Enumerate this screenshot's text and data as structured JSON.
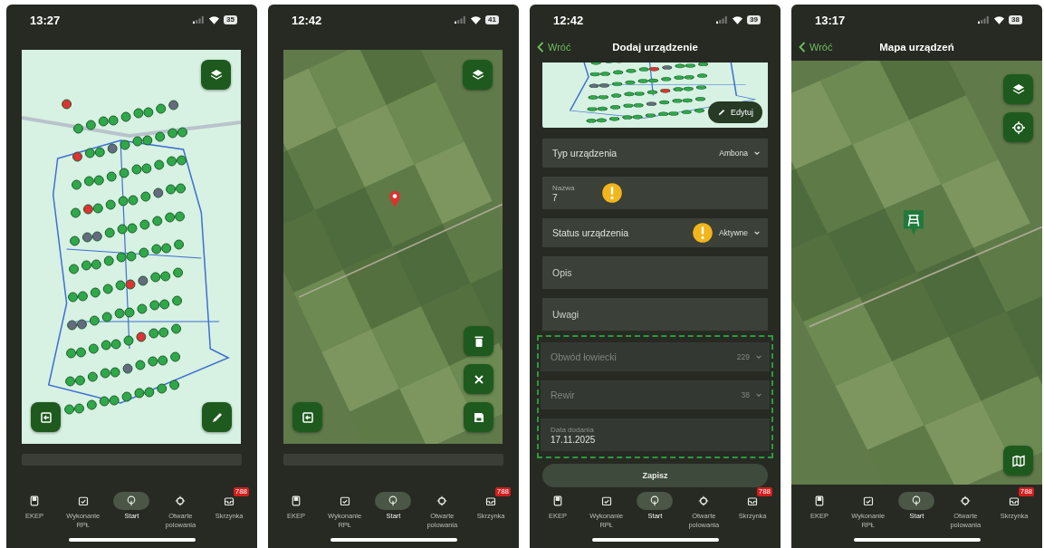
{
  "screens": [
    {
      "kind": "device_map",
      "status": {
        "time": "13:27",
        "battery": "35"
      },
      "nav": [
        {
          "label": "EKEP",
          "selected": false
        },
        {
          "label": "Wykonanie RPŁ",
          "selected": false
        },
        {
          "label": "Start",
          "selected": true
        },
        {
          "label": "Otwarte polowania",
          "selected": false
        },
        {
          "label": "Skrzynka",
          "selected": false,
          "badge": "788"
        }
      ]
    },
    {
      "kind": "device_edit_map",
      "status": {
        "time": "12:42",
        "battery": "41"
      },
      "nav": [
        {
          "label": "EKEP",
          "selected": false
        },
        {
          "label": "Wykonanie RPŁ",
          "selected": false
        },
        {
          "label": "Start",
          "selected": true
        },
        {
          "label": "Otwarte polowania",
          "selected": false
        },
        {
          "label": "Skrzynka",
          "selected": false,
          "badge": "788"
        }
      ]
    },
    {
      "kind": "device_form",
      "status": {
        "time": "12:42",
        "battery": "39"
      },
      "header": {
        "back": "Wróć",
        "title": "Dodaj urządzenie"
      },
      "map_button": "Edytuj",
      "fields": [
        {
          "kind": "select",
          "label": "Typ urządzenia",
          "value": "Ambona",
          "warning": false,
          "disabled": false
        },
        {
          "kind": "text",
          "label": "Nazwa",
          "value": "7",
          "warning": true,
          "disabled": false
        },
        {
          "kind": "select",
          "label": "Status urządzenia",
          "value": "Aktywne",
          "warning": true,
          "disabled": false
        },
        {
          "kind": "empty",
          "placeholder": "Opis",
          "warning": false,
          "disabled": false
        },
        {
          "kind": "empty",
          "placeholder": "Uwagi",
          "warning": false,
          "disabled": false
        }
      ],
      "locked_fields": [
        {
          "kind": "select",
          "label": "Obwód łowiecki",
          "value": "229",
          "warning": false,
          "disabled": true
        },
        {
          "kind": "select",
          "label": "Rewir",
          "value": "38",
          "warning": false,
          "disabled": true
        },
        {
          "kind": "text",
          "label": "Data dodania",
          "value": "17.11.2025",
          "warning": false,
          "disabled": true
        }
      ],
      "submit": "Zapisz",
      "nav": [
        {
          "label": "EKEP",
          "selected": false
        },
        {
          "label": "Wykonanie RPŁ",
          "selected": false
        },
        {
          "label": "Start",
          "selected": true
        },
        {
          "label": "Otwarte polowania",
          "selected": false
        },
        {
          "label": "Skrzynka",
          "selected": false,
          "badge": "788"
        }
      ]
    },
    {
      "kind": "device_map_view",
      "status": {
        "time": "13:17",
        "battery": "38"
      },
      "header": {
        "back": "Wróć",
        "title": "Mapa urządzeń"
      },
      "nav": [
        {
          "label": "EKEP",
          "selected": false
        },
        {
          "label": "Wykonanie RPŁ",
          "selected": false
        },
        {
          "label": "Start",
          "selected": true
        },
        {
          "label": "Otwarte polowania",
          "selected": false
        },
        {
          "label": "Skrzynka",
          "selected": false,
          "badge": "788"
        }
      ]
    }
  ]
}
